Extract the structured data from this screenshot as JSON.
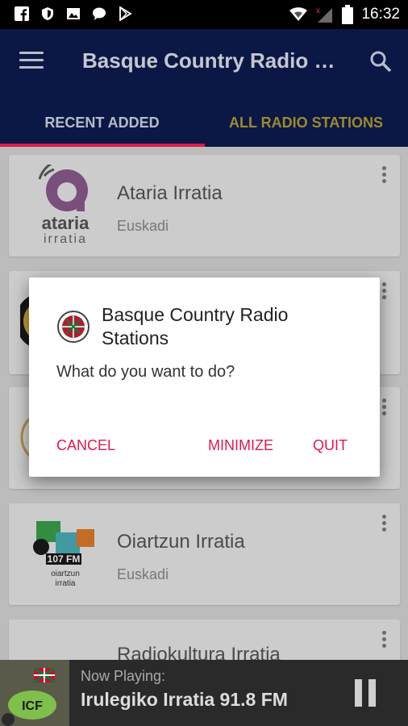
{
  "status_bar": {
    "time": "16:32",
    "left_icons": [
      "facebook-icon",
      "shield-icon",
      "image-icon",
      "chat-bubble-icon",
      "play-store-icon"
    ],
    "right_icons": [
      "wifi-icon",
      "no-signal-icon",
      "battery-icon"
    ]
  },
  "app_bar": {
    "title": "Basque Country Radio Stations",
    "menu_icon": "hamburger-menu-icon",
    "search_icon": "search-icon"
  },
  "tabs": [
    {
      "label": "RECENT ADDED",
      "active": true
    },
    {
      "label": "ALL RADIO STATIONS",
      "active": false
    }
  ],
  "colors": {
    "app_bar": "#0b1845",
    "accent": "#d91e48",
    "tab_inactive": "#9c8a2c",
    "dialog_button": "#e0184a"
  },
  "stations": [
    {
      "name": "Ataria Irratia",
      "region": "Euskadi",
      "logo_text": "ataria irratia"
    },
    {
      "name": "",
      "region": ""
    },
    {
      "name": "",
      "region": ""
    },
    {
      "name": "Oiartzun Irratia",
      "region": "Euskadi",
      "logo_text": "107 FM oiartzun irratia"
    },
    {
      "name": "Radiokultura Irratia",
      "region": ""
    }
  ],
  "dialog": {
    "title": "Basque Country Radio Stations",
    "message": "What do you want to do?",
    "buttons": {
      "cancel": "CANCEL",
      "minimize": "MINIMIZE",
      "quit": "QUIT"
    }
  },
  "player": {
    "label": "Now Playing:",
    "station": "Irulegiko Irratia 91.8 FM",
    "state_icon": "pause-icon"
  }
}
